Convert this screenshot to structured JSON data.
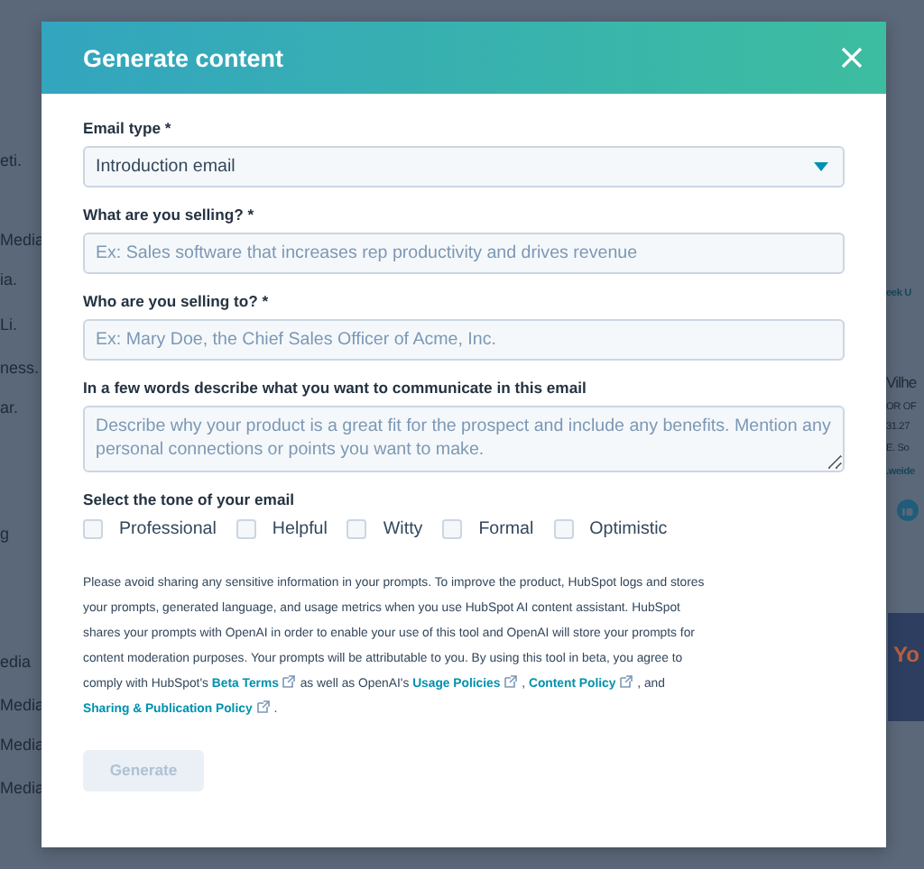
{
  "background": {
    "left_fragments": [
      "eti.",
      "Media",
      "ia.",
      "Li.",
      "ness.",
      "ar.",
      "g",
      "edia",
      "Media",
      "Media",
      "Media"
    ],
    "right_fragments": [
      "eek U",
      "Vilhe",
      "OR OF",
      "31.27",
      "E. So",
      ".weide"
    ],
    "banner_text": "Yo"
  },
  "dialog": {
    "title": "Generate content",
    "fields": [
      {
        "kind": "select",
        "label": "Email type *",
        "value": "Introduction email"
      },
      {
        "kind": "input",
        "label": "What are you selling? *",
        "placeholder": "Ex: Sales software that increases rep productivity and drives revenue"
      },
      {
        "kind": "input",
        "label": "Who are you selling to? *",
        "placeholder": "Ex: Mary Doe, the Chief Sales Officer of Acme, Inc."
      },
      {
        "kind": "textarea",
        "label": "In a few words describe what you want to communicate in this email",
        "placeholder": "Describe why your product is a great fit for the prospect and include any benefits. Mention any personal connections or points you want to make."
      }
    ],
    "tone": {
      "label": "Select the tone of your email",
      "options": [
        {
          "label": "Professional",
          "checked": false
        },
        {
          "label": "Helpful",
          "checked": false
        },
        {
          "label": "Witty",
          "checked": false
        },
        {
          "label": "Formal",
          "checked": false
        },
        {
          "label": "Optimistic",
          "checked": false
        }
      ]
    },
    "disclaimer": [
      {
        "kind": "text",
        "text": "Please avoid sharing any sensitive information in your prompts. To improve the product, HubSpot logs and stores your prompts, generated language, and usage metrics when you use HubSpot AI content assistant. HubSpot shares your prompts with OpenAI in order to enable your use of this tool and OpenAI will store your prompts for content moderation purposes. Your prompts will be attributable to you. By using this tool in beta, you agree to comply with HubSpot's "
      },
      {
        "kind": "link",
        "text": "Beta Terms"
      },
      {
        "kind": "text",
        "text": " as well as OpenAI's "
      },
      {
        "kind": "link",
        "text": "Usage Policies"
      },
      {
        "kind": "text",
        "text": " , "
      },
      {
        "kind": "link",
        "text": "Content Policy"
      },
      {
        "kind": "text",
        "text": " , and "
      },
      {
        "kind": "link",
        "text": "Sharing & Publication Policy"
      },
      {
        "kind": "text",
        "text": " ."
      }
    ],
    "generate_button": {
      "label": "Generate",
      "disabled": true
    }
  }
}
